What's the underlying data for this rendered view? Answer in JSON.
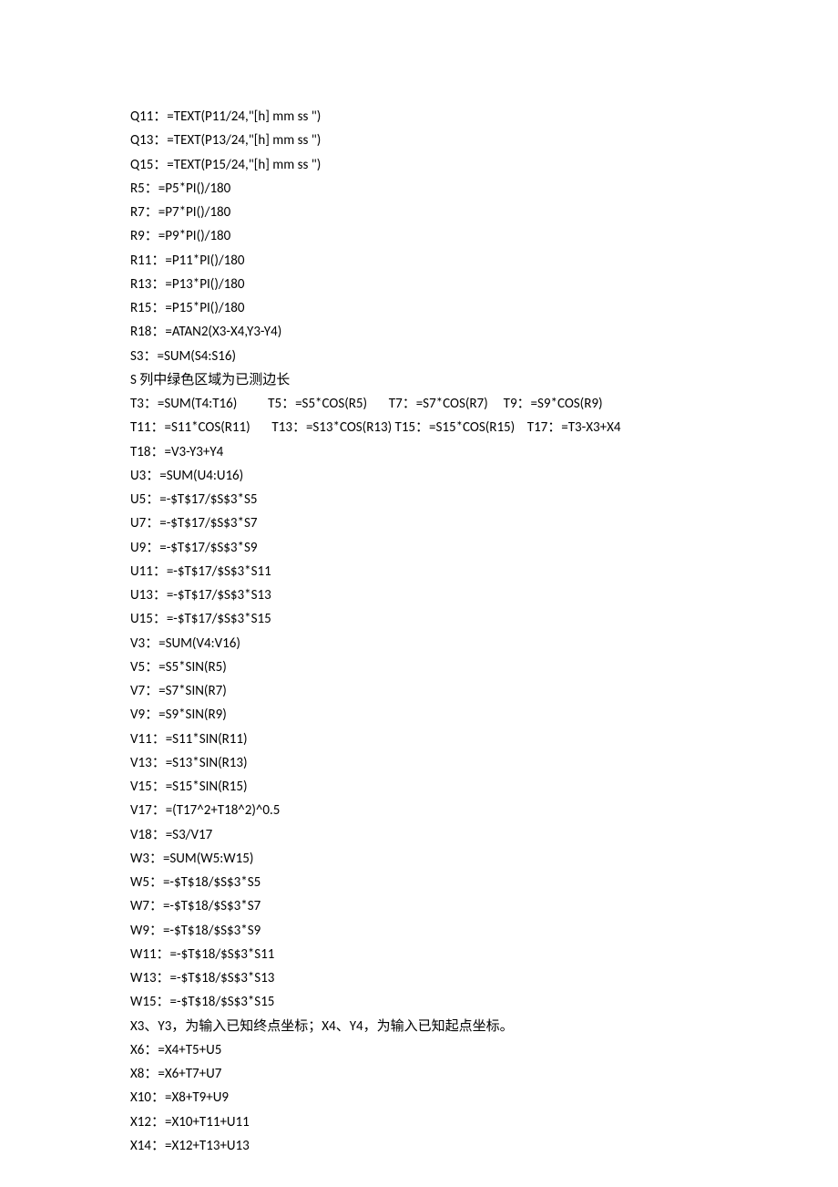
{
  "lines": [
    "Q11：=TEXT(P11/24,\"[h] mm ss \")",
    "Q13：=TEXT(P13/24,\"[h] mm ss \")",
    "Q15：=TEXT(P15/24,\"[h] mm ss \")",
    "R5：=P5*PI()/180",
    "R7：=P7*PI()/180",
    "R9：=P9*PI()/180",
    "R11：=P11*PI()/180",
    "R13：=P13*PI()/180",
    "R15：=P15*PI()/180",
    "R18：=ATAN2(X3-X4,Y3-Y4)",
    "S3：=SUM(S4:S16)",
    "S 列中绿色区域为已测边长",
    "T3：=SUM(T4:T16)          T5：=S5*COS(R5)       T7：=S7*COS(R7)     T9：=S9*COS(R9)",
    "T11：=S11*COS(R11)       T13：=S13*COS(R13) T15：=S15*COS(R15)    T17：=T3-X3+X4",
    "T18：=V3-Y3+Y4",
    "U3：=SUM(U4:U16)",
    "U5：=-$T$17/$S$3*S5",
    "U7：=-$T$17/$S$3*S7",
    "U9：=-$T$17/$S$3*S9",
    "U11：=-$T$17/$S$3*S11",
    "U13：=-$T$17/$S$3*S13",
    "U15：=-$T$17/$S$3*S15",
    "V3：=SUM(V4:V16)",
    "V5：=S5*SIN(R5)",
    "V7：=S7*SIN(R7)",
    "V9：=S9*SIN(R9)",
    "V11：=S11*SIN(R11)",
    "V13：=S13*SIN(R13)",
    "V15：=S15*SIN(R15)",
    "V17：=(T17^2+T18^2)^0.5",
    "V18：=S3/V17",
    "W3：=SUM(W5:W15)",
    "W5：=-$T$18/$S$3*S5",
    "W7：=-$T$18/$S$3*S7",
    "W9：=-$T$18/$S$3*S9",
    "W11：=-$T$18/$S$3*S11",
    "W13：=-$T$18/$S$3*S13",
    "W15：=-$T$18/$S$3*S15",
    "X3、Y3，为输入已知终点坐标；X4、Y4，为输入已知起点坐标。",
    "X6：=X4+T5+U5",
    "X8：=X6+T7+U7",
    "X10：=X8+T9+U9",
    "X12：=X10+T11+U11",
    "X14：=X12+T13+U13"
  ]
}
